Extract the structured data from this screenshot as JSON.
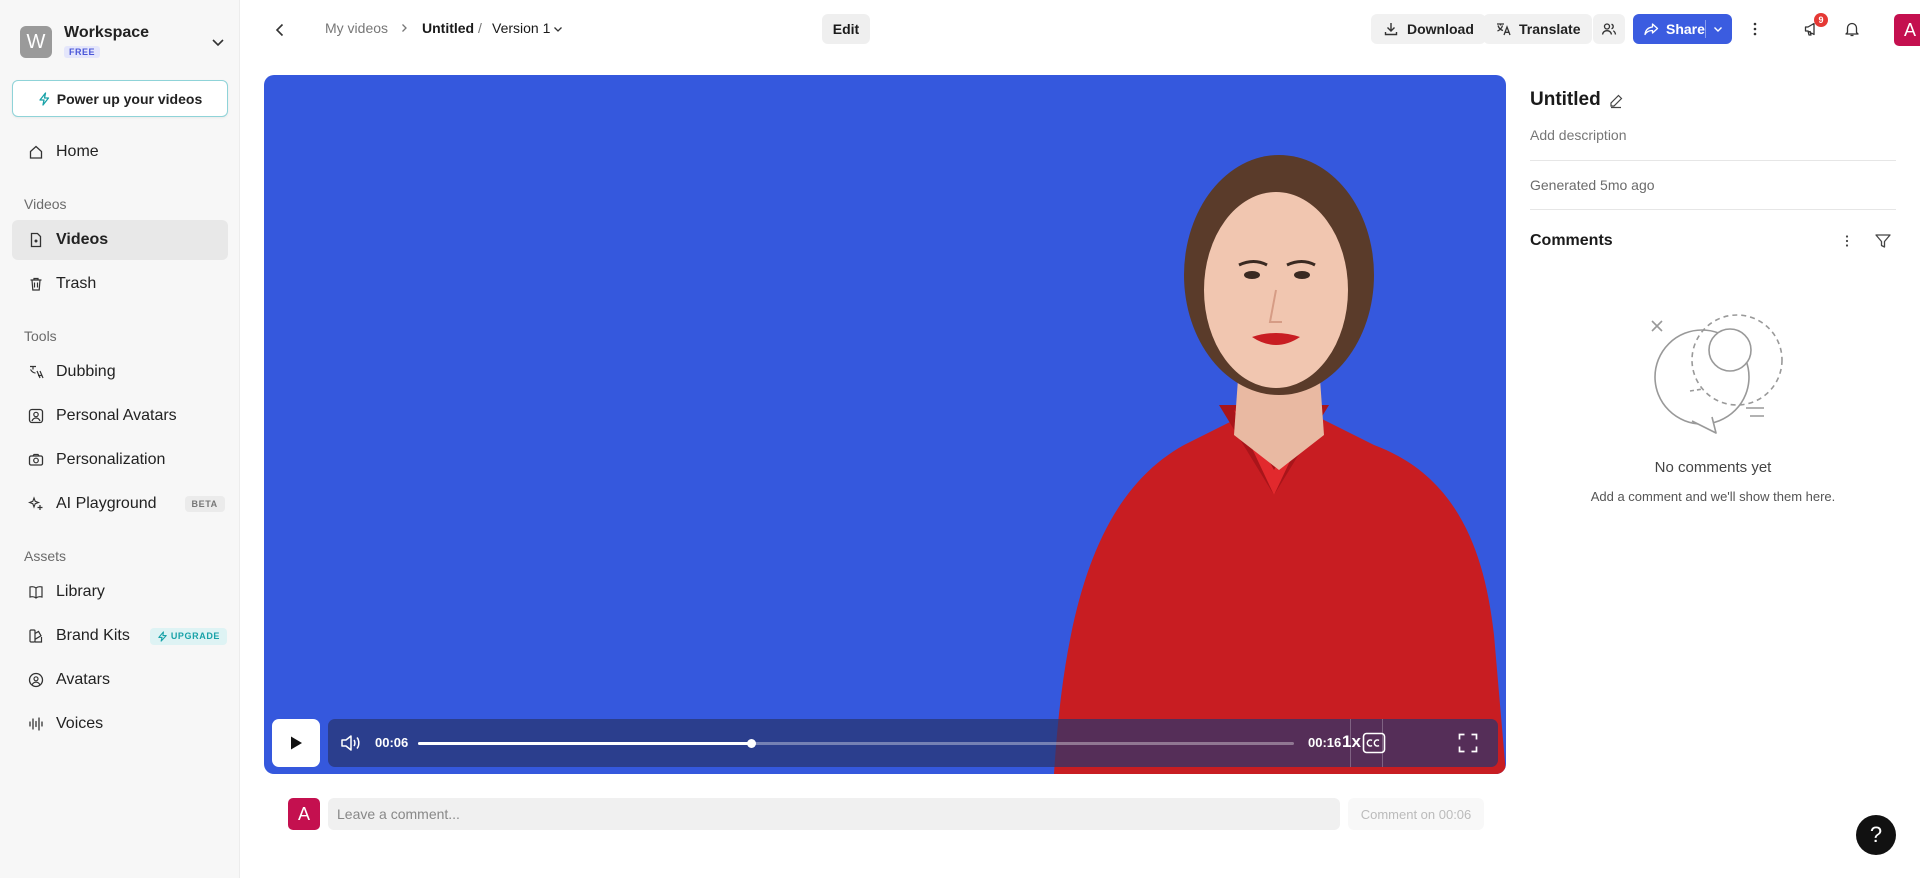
{
  "workspace": {
    "initial": "W",
    "name": "Workspace",
    "plan": "FREE"
  },
  "power_up_label": "Power up your videos",
  "nav": {
    "home": "Home",
    "section_videos": "Videos",
    "videos": "Videos",
    "trash": "Trash",
    "section_tools": "Tools",
    "dubbing": "Dubbing",
    "personal_avatars": "Personal Avatars",
    "personalization": "Personalization",
    "ai_playground": "AI Playground",
    "ai_playground_badge": "BETA",
    "section_assets": "Assets",
    "library": "Library",
    "brand_kits": "Brand Kits",
    "brand_kits_badge": "UPGRADE",
    "avatars": "Avatars",
    "voices": "Voices"
  },
  "breadcrumb": {
    "parent": "My videos",
    "current": "Untitled",
    "separator": "/",
    "version": "Version 1"
  },
  "toolbar": {
    "edit": "Edit",
    "download": "Download",
    "translate": "Translate",
    "share": "Share",
    "notification_count": "9",
    "user_initial": "A"
  },
  "player": {
    "current_time": "00:06",
    "duration": "00:16",
    "progress_fraction": 0.38,
    "speed": "1x"
  },
  "comment_bar": {
    "avatar_initial": "A",
    "placeholder": "Leave a comment...",
    "submit": "Comment on 00:06"
  },
  "panel": {
    "title": "Untitled",
    "description": "Add description",
    "generated": "Generated 5mo ago",
    "comments_title": "Comments",
    "empty_title": "No comments yet",
    "empty_subtitle": "Add a comment and we'll show them here."
  },
  "help_label": "?",
  "colors": {
    "accent": "#3b5ce0",
    "video_bg": "#3558dd",
    "avatar": "#c4104f",
    "teal": "#19a2a8"
  }
}
